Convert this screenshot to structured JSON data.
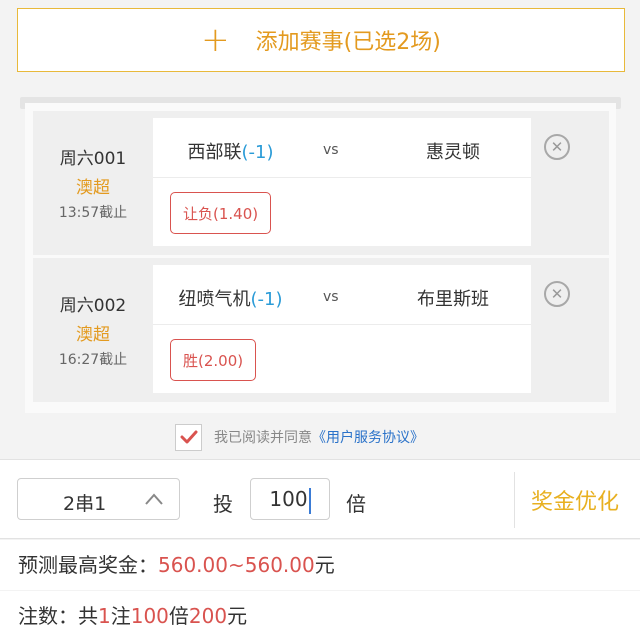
{
  "add_bar": {
    "icon": "plus-icon",
    "label": "添加赛事(已选2场)"
  },
  "matches": [
    {
      "id": "周六001",
      "league": "澳超",
      "deadline": "13:57截止",
      "home": "西部联",
      "handicap": "(-1)",
      "vs": "vs",
      "away": "惠灵顿",
      "odds": "让负(1.40)"
    },
    {
      "id": "周六002",
      "league": "澳超",
      "deadline": "16:27截止",
      "home": "纽喷气机",
      "handicap": "(-1)",
      "vs": "vs",
      "away": "布里斯班",
      "odds": "胜(2.00)"
    }
  ],
  "agreement": {
    "text": "我已阅读并同意",
    "link": "《用户服务协议》",
    "checked": true
  },
  "bet": {
    "series": "2串1",
    "bet_label": "投",
    "multiplier": "100",
    "times_label": "倍",
    "optimize_label": "奖金优化"
  },
  "prize": {
    "label": "预测最高奖金：",
    "value": "560.00~560.00",
    "unit": "元"
  },
  "summary": {
    "label": "注数：",
    "p1": "共",
    "count": "1",
    "p2": "注",
    "mult": "100",
    "p3": "倍",
    "amount": "200",
    "p4": "元"
  },
  "colors": {
    "accent": "#e39a1f",
    "odds_red": "#d9534f",
    "link_blue": "#2a72c9",
    "handicap_blue": "#2a9bd7"
  }
}
